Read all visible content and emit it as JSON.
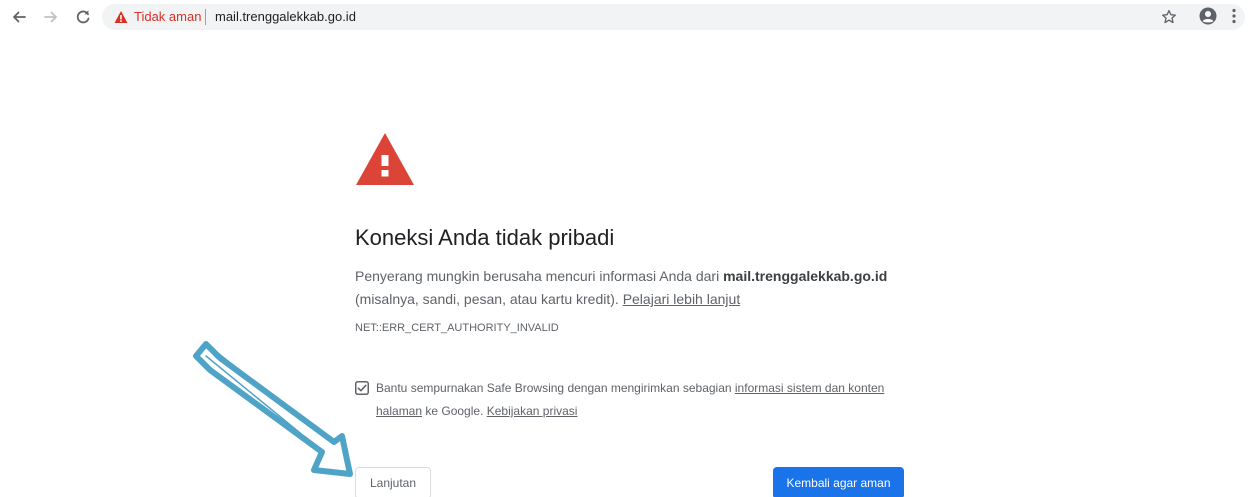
{
  "toolbar": {
    "back_icon": "arrow-left-icon",
    "forward_icon": "arrow-right-icon",
    "reload_icon": "reload-icon",
    "omnibox": {
      "security_icon": "warning-triangle-icon",
      "security_label": "Tidak aman",
      "url": "mail.trenggalekkab.go.id",
      "bookmark_icon": "star-icon"
    },
    "profile_icon": "account-circle-icon",
    "menu_icon": "vertical-dots-icon"
  },
  "interstitial": {
    "icon": "warning-triangle-icon",
    "headline": "Koneksi Anda tidak pribadi",
    "description": {
      "part1": "Penyerang mungkin berusaha mencuri informasi Anda dari ",
      "host": "mail.trenggalekkab.go.id",
      "part2": " (misalnya, sandi, pesan, atau kartu kredit). ",
      "learn_more": "Pelajari lebih lanjut"
    },
    "error_code": "NET::ERR_CERT_AUTHORITY_INVALID",
    "safe_browsing": {
      "checked": true,
      "text1": "Bantu sempurnakan Safe Browsing dengan mengirimkan sebagian ",
      "link1": "informasi sistem dan konten halaman",
      "text2": " ke Google. ",
      "link2": "Kebijakan privasi"
    },
    "advanced_button": "Lanjutan",
    "back_button": "Kembali agar aman"
  },
  "annotation": {
    "icon": "pointer-arrow-icon"
  },
  "colors": {
    "danger": "#d93025",
    "icon_red": "#db4437",
    "primary_button": "#1a73e8",
    "annotation_arrow": "#4fa3c7"
  }
}
